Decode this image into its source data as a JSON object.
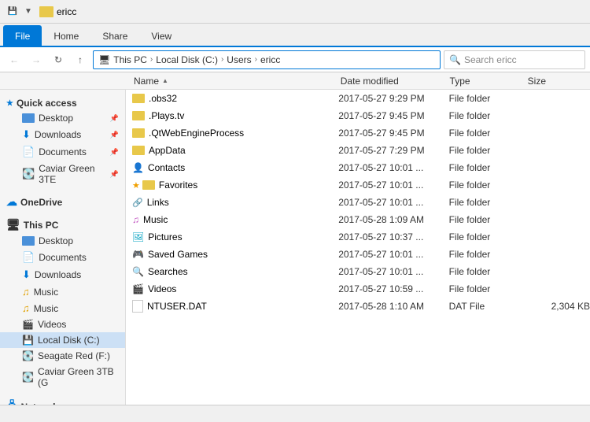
{
  "titleBar": {
    "title": "ericc",
    "icons": [
      "minimize",
      "maximize",
      "close"
    ]
  },
  "ribbonTabs": [
    {
      "label": "File",
      "active": true
    },
    {
      "label": "Home",
      "active": false
    },
    {
      "label": "Share",
      "active": false
    },
    {
      "label": "View",
      "active": false
    }
  ],
  "addressBar": {
    "back": "←",
    "forward": "→",
    "up": "↑",
    "pathParts": [
      "This PC",
      "Local Disk (C:)",
      "Users",
      "ericc"
    ],
    "searchPlaceholder": "Search ericc"
  },
  "columnHeaders": {
    "name": "Name",
    "dateModified": "Date modified",
    "type": "Type",
    "size": "Size"
  },
  "sidebar": {
    "quickAccess": {
      "label": "Quick access",
      "items": [
        {
          "name": "Desktop",
          "pinned": true
        },
        {
          "name": "Downloads",
          "pinned": true
        },
        {
          "name": "Documents",
          "pinned": true
        },
        {
          "name": "Caviar Green 3TE",
          "pinned": true
        }
      ]
    },
    "oneDrive": {
      "label": "OneDrive"
    },
    "thisPC": {
      "label": "This PC",
      "items": [
        {
          "name": "Desktop"
        },
        {
          "name": "Documents"
        },
        {
          "name": "Downloads"
        },
        {
          "name": "Music"
        },
        {
          "name": "Music"
        },
        {
          "name": "Videos"
        },
        {
          "name": "Local Disk (C:)",
          "active": true
        },
        {
          "name": "Seagate Red (F:)"
        },
        {
          "name": "Caviar Green 3TB (G"
        }
      ]
    },
    "network": {
      "label": "Network"
    }
  },
  "files": [
    {
      "name": ".obs32",
      "dateModified": "2017-05-27 9:29 PM",
      "type": "File folder",
      "size": "",
      "icon": "folder"
    },
    {
      "name": ".Plays.tv",
      "dateModified": "2017-05-27 9:45 PM",
      "type": "File folder",
      "size": "",
      "icon": "folder"
    },
    {
      "name": ".QtWebEngineProcess",
      "dateModified": "2017-05-27 9:45 PM",
      "type": "File folder",
      "size": "",
      "icon": "folder"
    },
    {
      "name": "AppData",
      "dateModified": "2017-05-27 7:29 PM",
      "type": "File folder",
      "size": "",
      "icon": "folder"
    },
    {
      "name": "Contacts",
      "dateModified": "2017-05-27 10:01 ...",
      "type": "File folder",
      "size": "",
      "icon": "contacts"
    },
    {
      "name": "Favorites",
      "dateModified": "2017-05-27 10:01 ...",
      "type": "File folder",
      "size": "",
      "icon": "star"
    },
    {
      "name": "Links",
      "dateModified": "2017-05-27 10:01 ...",
      "type": "File folder",
      "size": "",
      "icon": "links"
    },
    {
      "name": "Music",
      "dateModified": "2017-05-28 1:09 AM",
      "type": "File folder",
      "size": "",
      "icon": "music"
    },
    {
      "name": "Pictures",
      "dateModified": "2017-05-27 10:37 ...",
      "type": "File folder",
      "size": "",
      "icon": "pictures"
    },
    {
      "name": "Saved Games",
      "dateModified": "2017-05-27 10:01 ...",
      "type": "File folder",
      "size": "",
      "icon": "saved"
    },
    {
      "name": "Searches",
      "dateModified": "2017-05-27 10:01 ...",
      "type": "File folder",
      "size": "",
      "icon": "searches"
    },
    {
      "name": "Videos",
      "dateModified": "2017-05-27 10:59 ...",
      "type": "File folder",
      "size": "",
      "icon": "videos"
    },
    {
      "name": "NTUSER.DAT",
      "dateModified": "2017-05-28 1:10 AM",
      "type": "DAT File",
      "size": "2,304 KB",
      "icon": "dat"
    }
  ],
  "statusBar": {
    "text": ""
  }
}
